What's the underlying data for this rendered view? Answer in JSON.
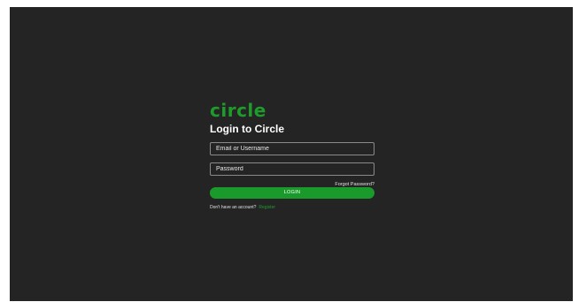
{
  "brand": {
    "logo_text": "circle",
    "accent_color": "#1f9b2c"
  },
  "login": {
    "heading": "Login to Circle",
    "username_placeholder": "Email or Username",
    "password_placeholder": "Password",
    "forgot_password_label": "Forgot Password?",
    "submit_label": "LOGIN",
    "no_account_text": "Don't have an account?",
    "register_label": "Register"
  },
  "colors": {
    "background": "#242424",
    "accent": "#1f9b2c",
    "text": "#ffffff"
  }
}
